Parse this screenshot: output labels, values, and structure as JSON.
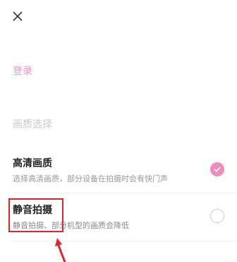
{
  "header": {
    "close_icon": "close-icon"
  },
  "login": {
    "label": "登录"
  },
  "quality_section": {
    "title": "画质选择"
  },
  "options": [
    {
      "title": "高清画质",
      "description": "选择高清画质，部分设备在拍摄时会有快门声",
      "selected": true
    },
    {
      "title": "静音拍摄",
      "description": "静音拍摄、部分机型的画质会降低",
      "selected": false
    }
  ],
  "colors": {
    "accent": "#f08bbd",
    "annotation": "#e0242b"
  }
}
